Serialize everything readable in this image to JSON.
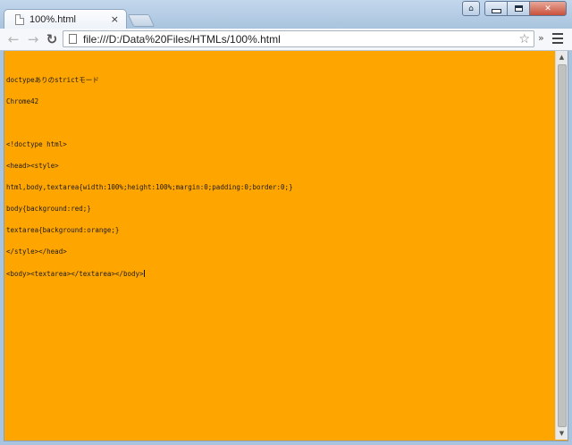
{
  "tab": {
    "title": "100%.html",
    "close_glyph": "×"
  },
  "window_controls": {
    "profile_glyph": "⌂",
    "close_glyph": "✕"
  },
  "toolbar": {
    "back_glyph": "←",
    "forward_glyph": "→",
    "reload_glyph": "↻",
    "url": "file:///D:/Data%20Files/HTMLs/100%.html",
    "star_glyph": "☆",
    "extensions_glyph": "»"
  },
  "page": {
    "background_color": "#ffa500",
    "lines": [
      "doctypeありのstrictモード",
      "Chrome42",
      "",
      "<!doctype html>",
      "<head><style>",
      "html,body,textarea{width:100%;height:100%;margin:0;padding:0;border:0;}",
      "body{background:red;}",
      "textarea{background:orange;}",
      "</style></head>",
      "<body><textarea></textarea></body>"
    ]
  },
  "scrollbar": {
    "up_glyph": "▲",
    "down_glyph": "▼"
  }
}
